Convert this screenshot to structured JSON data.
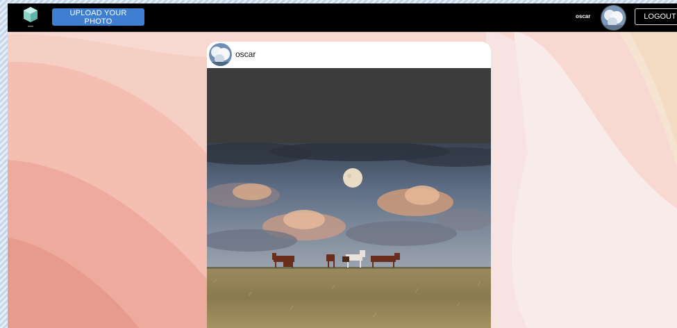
{
  "navbar": {
    "upload_label": "UPLOAD YOUR PHOTO",
    "username": "oscar",
    "logout_label": "LOGOUT"
  },
  "post": {
    "username": "oscar"
  },
  "colors": {
    "navbar_bg": "#000000",
    "upload_button": "#3f7fd1",
    "background_pink": "#f8d8d0",
    "background_peach": "#f6e3d2"
  },
  "icons": {
    "logo": "hexagon-logo-icon",
    "avatar": "sky-avatar"
  }
}
